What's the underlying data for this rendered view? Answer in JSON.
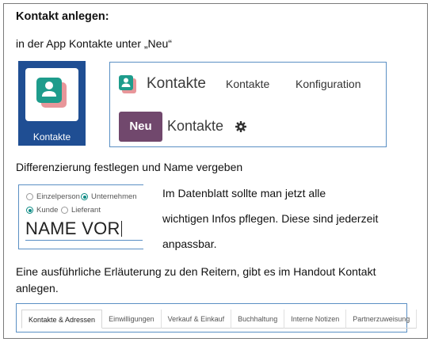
{
  "heading": "Kontakt anlegen:",
  "intro": "in der App Kontakte unter „Neu“",
  "app_tile": {
    "label": "Kontakte",
    "bg_color": "#1f4e93",
    "icon": "contacts-app-icon"
  },
  "nav": {
    "app_title": "Kontakte",
    "menu": [
      "Kontakte",
      "Konfiguration"
    ],
    "new_button": "Neu",
    "breadcrumb": "Kontakte",
    "settings_icon": "gear-icon",
    "accent_color": "#71486d"
  },
  "differentiation": "Differenzierung festlegen und Name vergeben",
  "form": {
    "type_options": [
      {
        "label": "Einzelperson",
        "selected": false
      },
      {
        "label": "Unternehmen",
        "selected": true
      }
    ],
    "role_options": [
      {
        "label": "Kunde",
        "selected": true
      },
      {
        "label": "Lieferant",
        "selected": false
      }
    ],
    "name_value": "NAME VOR"
  },
  "info_lines": [
    "Im Datenblatt sollte man jetzt alle",
    "wichtigen Infos pflegen. Diese sind jederzeit",
    "anpassbar."
  ],
  "explanation": "Eine ausführliche Erläuterung zu den Reitern, gibt es im Handout Kontakt anlegen.",
  "tabs": [
    "Kontakte & Adressen",
    "Einwilligungen",
    "Verkauf & Einkauf",
    "Buchhaltung",
    "Interne Notizen",
    "Partnerzuweisung"
  ],
  "active_tab": "Kontakte & Adressen"
}
